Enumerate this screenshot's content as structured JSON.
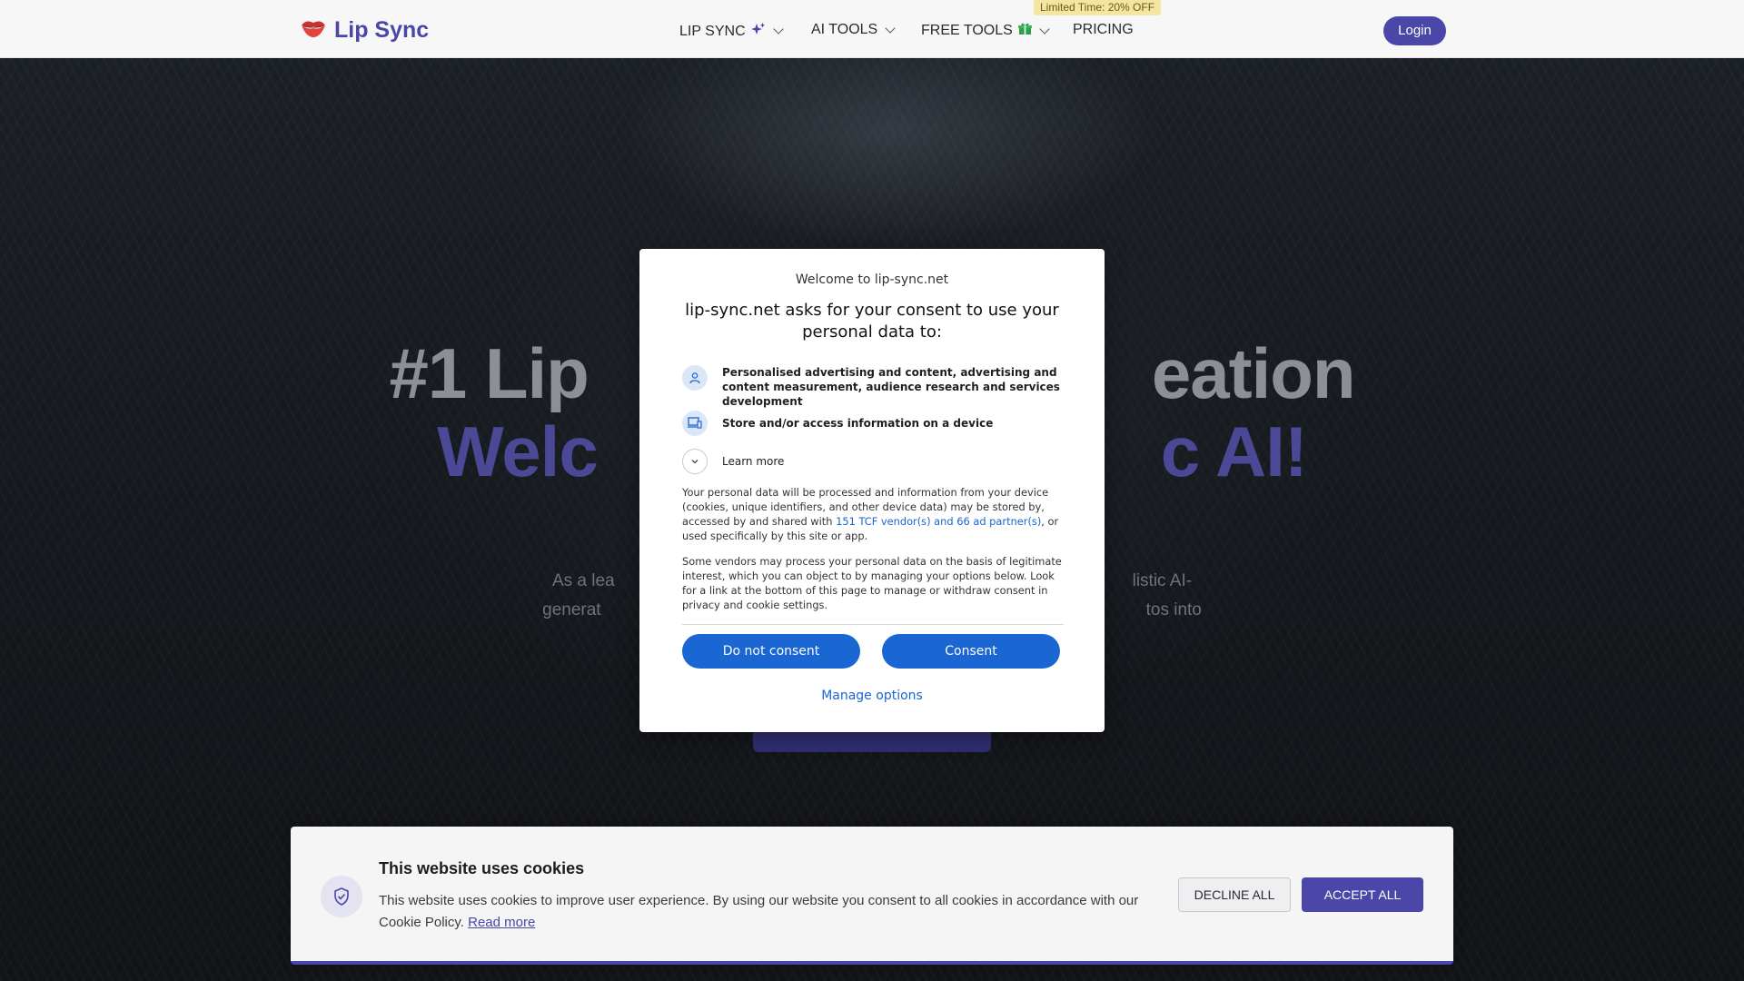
{
  "brand": {
    "name": "Lip Sync",
    "accent": "#4a47a8",
    "logo_icon": "lips-icon"
  },
  "nav": {
    "items": [
      {
        "label": "LIP SYNC",
        "icon": "sparkle-icon",
        "dropdown": true
      },
      {
        "label": "AI TOOLS",
        "dropdown": true
      },
      {
        "label": "FREE TOOLS",
        "icon": "gift-icon",
        "dropdown": true
      },
      {
        "label": "PRICING",
        "dropdown": false
      }
    ],
    "promo_badge": "Limited Time: 20% OFF",
    "login_label": "Login"
  },
  "hero": {
    "line1_visible": [
      "#1 Lip",
      "eation"
    ],
    "line2_visible": [
      "Welc",
      "c AI!"
    ],
    "desc_line1_visible": [
      "As a lea",
      "listic AI-"
    ],
    "desc_line2_visible": [
      "generat",
      "tos into"
    ]
  },
  "consent_modal": {
    "welcome": "Welcome to lip-sync.net",
    "title": "lip-sync.net asks for your consent to use your personal data to:",
    "purposes": [
      {
        "icon": "person-icon",
        "text": "Personalised advertising and content, advertising and content measurement, audience research and services development"
      },
      {
        "icon": "device-icon",
        "text": "Store and/or access information on a device"
      }
    ],
    "learn_more": "Learn more",
    "paragraph1_before": "Your personal data will be processed and information from your device (cookies, unique identifiers, and other device data) may be stored by, accessed by and shared with ",
    "paragraph1_link": "151 TCF vendor(s) and 66 ad partner(s)",
    "paragraph1_after": ", or used specifically by this site or app.",
    "paragraph2": "Some vendors may process your personal data on the basis of legitimate interest, which you can object to by managing your options below. Look for a link at the bottom of this page to manage or withdraw consent in privacy and cookie settings.",
    "do_not_consent": "Do not consent",
    "consent": "Consent",
    "manage_options": "Manage options",
    "button_color": "#1a66d2"
  },
  "cookie_banner": {
    "title": "This website uses cookies",
    "text": "This website uses cookies to improve user experience. By using our website you consent to all cookies in accordance with our Cookie Policy.",
    "read_more": "Read more",
    "decline": "DECLINE ALL",
    "accept": "ACCEPT ALL",
    "icon": "shield-icon"
  }
}
